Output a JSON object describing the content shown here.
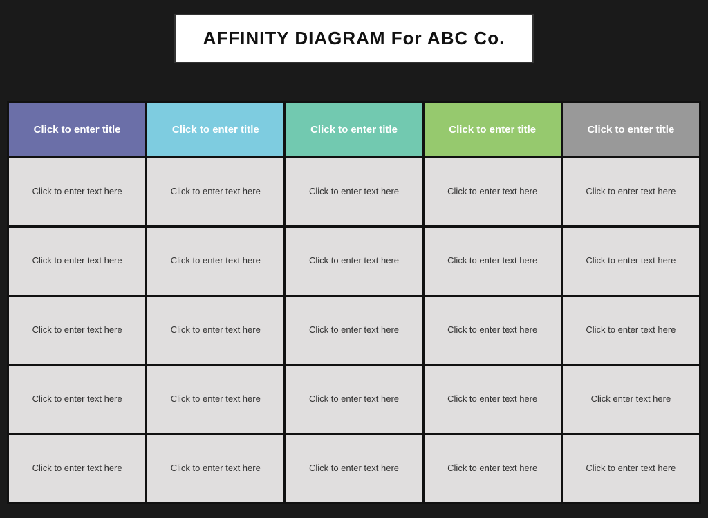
{
  "page": {
    "title": "AFFINITY DIAGRAM For ABC Co.",
    "background": "#1a1a1a"
  },
  "columns": [
    {
      "id": "col-0",
      "header": "Click to enter title",
      "color": "#6b6fa8",
      "cards": [
        "Click to enter text here",
        "Click to enter text here",
        "Click to enter text here",
        "Click to enter text here",
        "Click to enter text here"
      ]
    },
    {
      "id": "col-1",
      "header": "Click to enter title",
      "color": "#7ecce0",
      "cards": [
        "Click to enter text here",
        "Click to enter text here",
        "Click to enter text here",
        "Click to enter text here",
        "Click to enter text here"
      ]
    },
    {
      "id": "col-2",
      "header": "Click to enter title",
      "color": "#72c9b0",
      "cards": [
        "Click to enter text here",
        "Click to enter text here",
        "Click to enter text here",
        "Click to enter text here",
        "Click to enter text here"
      ]
    },
    {
      "id": "col-3",
      "header": "Click to enter title",
      "color": "#96c96e",
      "cards": [
        "Click to enter text here",
        "Click to enter text here",
        "Click to enter text here",
        "Click to enter text here",
        "Click to enter text here"
      ]
    },
    {
      "id": "col-4",
      "header": "Click to enter title",
      "color": "#999999",
      "cards": [
        "Click to enter text here",
        "Click to enter text here",
        "Click to enter text here",
        "Click enter text here",
        "Click to enter text here"
      ]
    }
  ]
}
